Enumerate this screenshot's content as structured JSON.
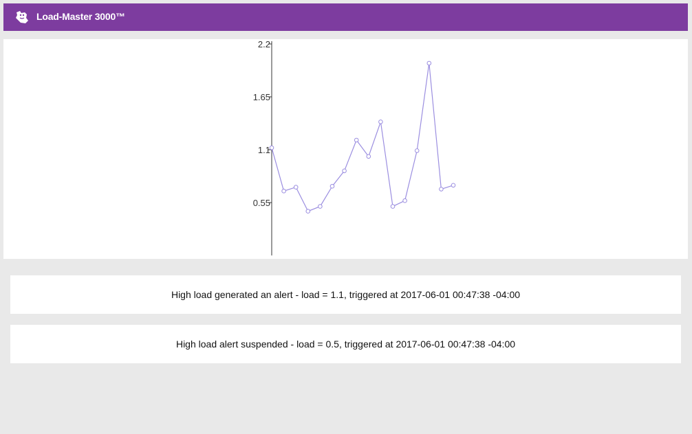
{
  "app": {
    "title": "Load-Master 3000™",
    "logo_icon": "datadog-dog-icon",
    "header_color": "#7d3c9f"
  },
  "chart_data": {
    "type": "line",
    "yticks": [
      "0.55",
      "1.1",
      "1.65",
      "2.2"
    ],
    "ylim": [
      0,
      2.2
    ],
    "line_color": "#9b8ee0",
    "grid": false,
    "series": [
      {
        "values": [
          1.12,
          0.67,
          0.71,
          0.46,
          0.51,
          0.72,
          0.88,
          1.2,
          1.03,
          1.39,
          0.51,
          0.57,
          1.09,
          2.0,
          0.69,
          0.73
        ]
      }
    ]
  },
  "alerts": [
    {
      "text": "High load generated an alert - load = 1.1, triggered at 2017-06-01 00:47:38 -04:00"
    },
    {
      "text": "High load alert suspended - load = 0.5, triggered at 2017-06-01 00:47:38 -04:00"
    }
  ]
}
